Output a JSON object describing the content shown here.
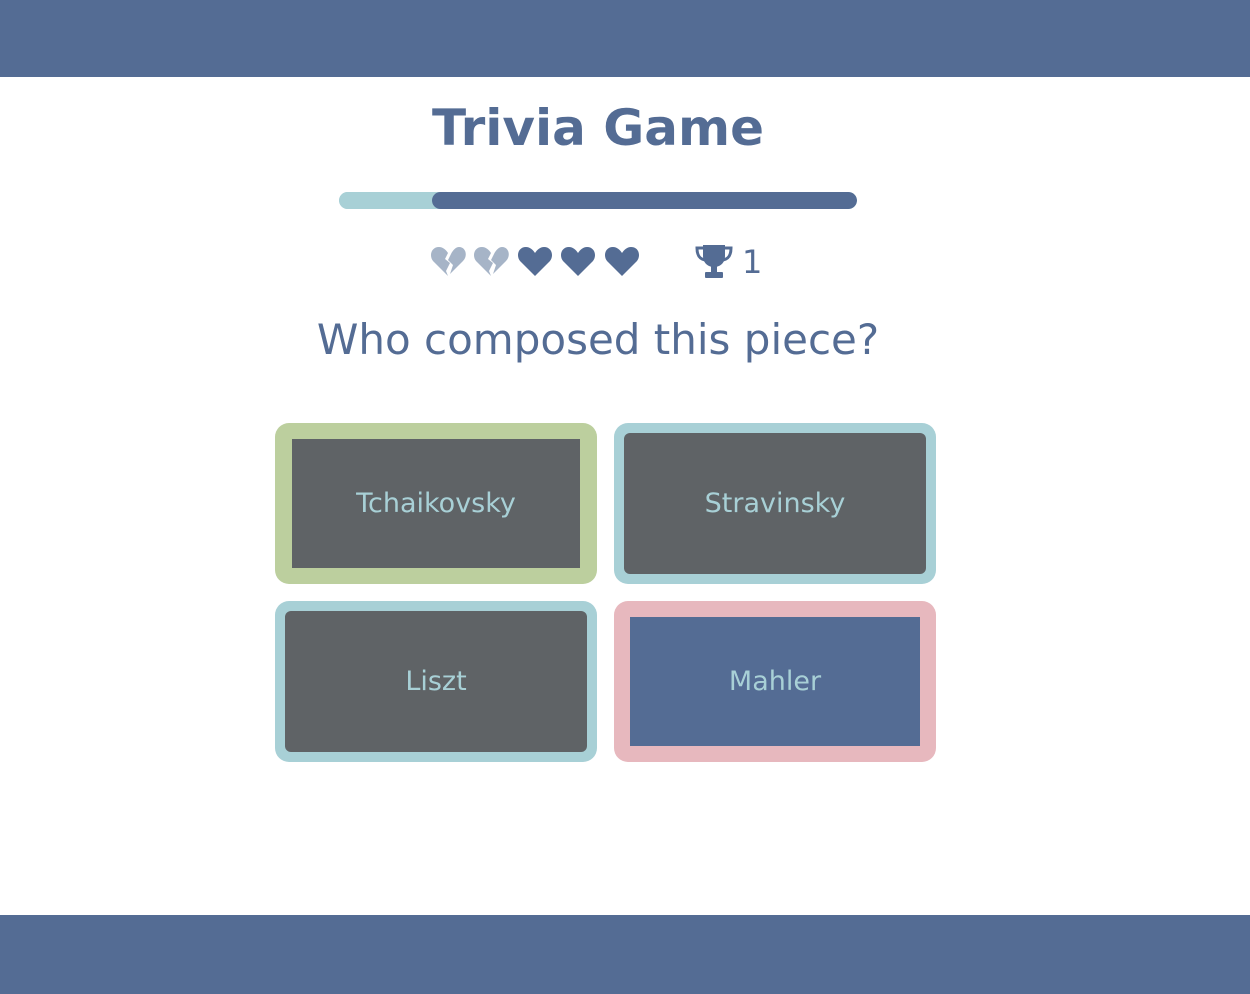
{
  "header": {
    "title": "Trivia Game"
  },
  "progress": {
    "value": 0.18
  },
  "lives": {
    "total": 5,
    "lost": 2,
    "remaining": 3
  },
  "score": {
    "icon": "trophy-icon",
    "value": "1"
  },
  "question": {
    "text": "Who composed this piece?"
  },
  "answers": [
    {
      "label": "Tchaikovsky",
      "state": "correct"
    },
    {
      "label": "Stravinsky",
      "state": "default"
    },
    {
      "label": "Liszt",
      "state": "default"
    },
    {
      "label": "Mahler",
      "state": "selected-wrong"
    }
  ],
  "colors": {
    "primary": "#546c94",
    "accent": "#a8d0d6",
    "correct": "#bccf9e",
    "wrong": "#e7b8be",
    "card": "#5f6366",
    "lost_heart": "#a6b4c7"
  }
}
